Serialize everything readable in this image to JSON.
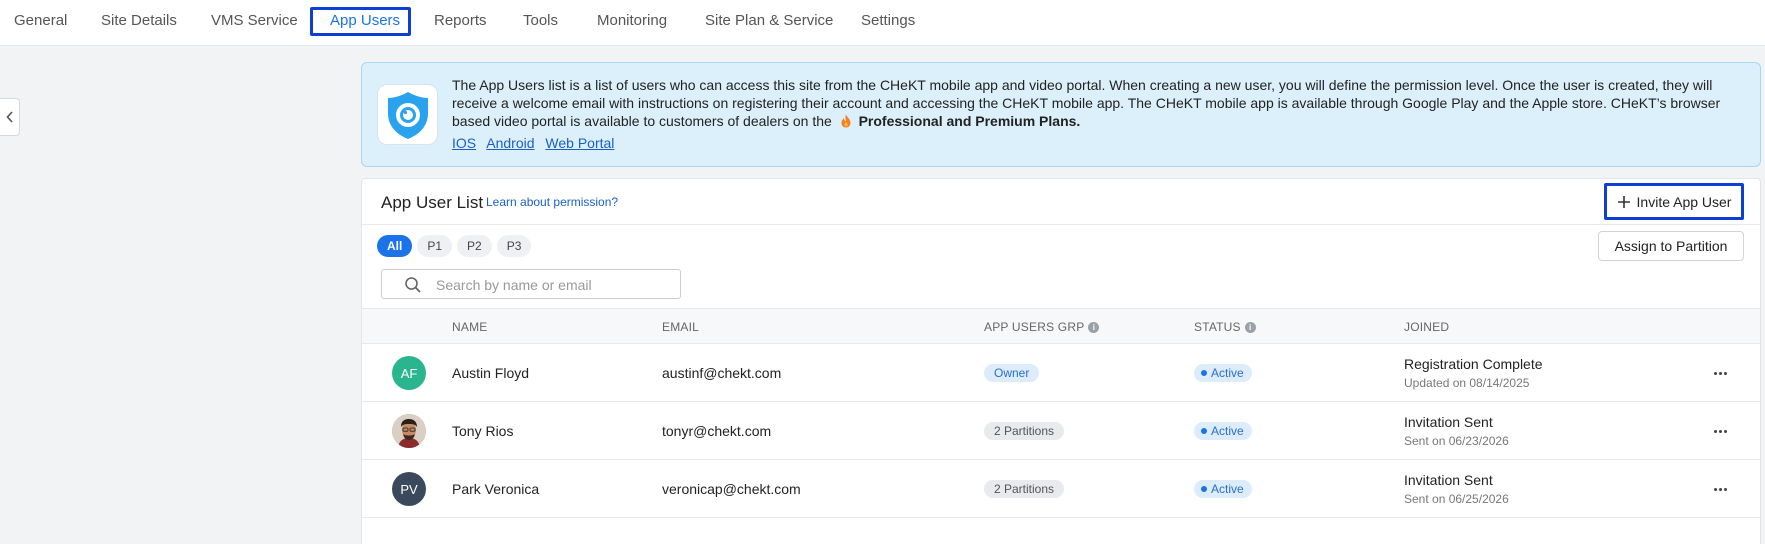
{
  "nav": {
    "tabs": [
      {
        "label": "General"
      },
      {
        "label": "Site Details"
      },
      {
        "label": "VMS Service"
      },
      {
        "label": "App Users"
      },
      {
        "label": "Reports"
      },
      {
        "label": "Tools"
      },
      {
        "label": "Monitoring"
      },
      {
        "label": "Site Plan & Service"
      },
      {
        "label": "Settings"
      }
    ],
    "active_tab": "App Users"
  },
  "banner": {
    "text": "The App Users list is a list of users who can access this site from the CHeKT mobile app and video portal. When creating a new user, you will define the permission level. Once the user is created, they will receive a welcome email with instructions on registering their account and accessing the CHeKT mobile app. The CHeKT mobile app is available through Google Play and the Apple store. CHeKT’s browser based video portal is available to customers of dealers on the",
    "plans_text": "Professional and Premium Plans.",
    "links": [
      "IOS",
      "Android",
      "Web Portal"
    ],
    "icon": "shield-eye-logo",
    "plan_icon": "fire-icon"
  },
  "card": {
    "title": "App User List",
    "learn_link": "Learn about permission?",
    "invite_label": "Invite App User",
    "assign_label": "Assign to Partition",
    "filters": [
      "All",
      "P1",
      "P2",
      "P3"
    ],
    "active_filter": "All",
    "search_placeholder": "Search by name or email"
  },
  "table": {
    "headers": {
      "name": "NAME",
      "email": "EMAIL",
      "group": "APP USERS GRP",
      "status": "STATUS",
      "joined": "JOINED"
    },
    "rows": [
      {
        "initials": "AF",
        "avatar_color": "#2bb58e",
        "name": "Austin Floyd",
        "email": "austinf@chekt.com",
        "group": "Owner",
        "status": "Active",
        "joined": "Registration Complete",
        "joined_sub": "Updated on 08/14/2025"
      },
      {
        "initials": "",
        "avatar_color": "#8a6a55",
        "name": "Tony Rios",
        "email": "tonyr@chekt.com",
        "group": "2 Partitions",
        "status": "Active",
        "joined": "Invitation Sent",
        "joined_sub": "Sent on 06/23/2026"
      },
      {
        "initials": "PV",
        "avatar_color": "#3a4a5c",
        "name": "Park Veronica",
        "email": "veronicap@chekt.com",
        "group": "2 Partitions",
        "status": "Active",
        "joined": "Invitation Sent",
        "joined_sub": "Sent on 06/25/2026"
      }
    ]
  },
  "colors": {
    "accent": "#1a73e8",
    "highlight": "#0d3fd6",
    "banner_bg": "#dcf0fb"
  }
}
